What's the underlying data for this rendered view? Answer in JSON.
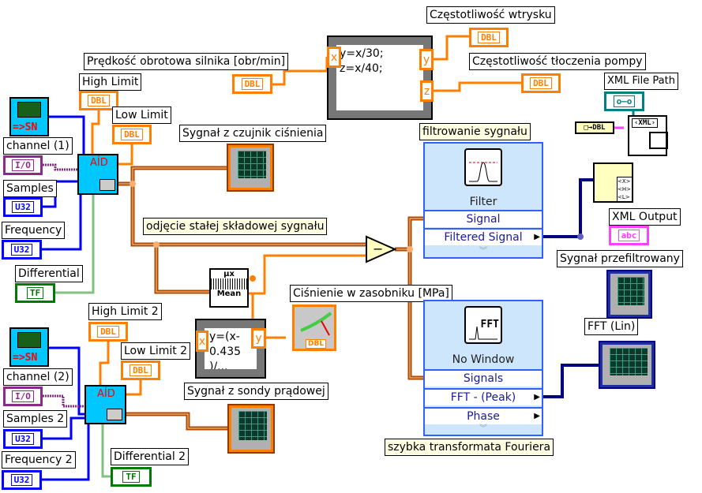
{
  "labels": {
    "injection_freq": "Częstotliwość wtrysku",
    "engine_speed": "Prędkość obrotowa silnika [obr/min]",
    "pump_freq": "Częstotliwość tłoczenia pompy",
    "xml_file_path": "XML File Path",
    "high_limit": "High Limit",
    "low_limit": "Low Limit",
    "channel_1": "channel (1)",
    "samples": "Samples",
    "frequency": "Frequency",
    "differential": "Differential",
    "pressure_sensor_signal": "Sygnał z czujnik ciśnienia",
    "dc_removal_note": "odjęcie stałej składowej sygnału",
    "filtering_note": "filtrowanie sygnału",
    "xml_output": "XML Output",
    "filtered_signal": "Sygnał przefiltrowany",
    "fft_lin": "FFT  (Lin)",
    "accumulator_pressure": "Ciśnienie w zasobniku [MPa]",
    "high_limit_2": "High Limit 2",
    "low_limit_2": "Low Limit 2",
    "channel_2": "channel (2)",
    "samples_2": "Samples 2",
    "frequency_2": "Frequency 2",
    "differential_2": "Differential 2",
    "current_probe_signal": "Sygnał z sondy prądowej",
    "fft_note": "szybka transformata Fouriera"
  },
  "terminals": {
    "dbl": "DBL",
    "u32": "U32",
    "io": "I/O",
    "tf": "TF",
    "abc": "abc",
    "dbl_small": "DBL"
  },
  "daq_icon_text": "=>SN",
  "ai_text": "AÍD",
  "formula1": {
    "x": "x",
    "y": "y",
    "z": "z",
    "code": "y=x/30;\nz=x/40;"
  },
  "formula2": {
    "x": "x",
    "y": "y",
    "code": "y=(x-\n0.435\n)/..."
  },
  "mean": {
    "top": "μx",
    "bottom": "Mean"
  },
  "subtract": "−",
  "filter_vi": {
    "caption": "Filter",
    "rows": [
      "Signal",
      "Filtered Signal"
    ]
  },
  "fft_vi": {
    "caption": "No Window",
    "icon_text": "FFT",
    "rows": [
      "Signals",
      "FFT - (Peak)",
      "Phase"
    ]
  },
  "xml": {
    "tag": "‹XML›",
    "bool_str": "DBL"
  },
  "colors": {
    "orange_wire": "#ff8000",
    "waveform_wire": "#b04a00",
    "blue_wire": "#0000ff",
    "xml_wire": "#ff40ff",
    "dark_blue_wire": "#000080",
    "express_vi": "#cde6fb"
  }
}
